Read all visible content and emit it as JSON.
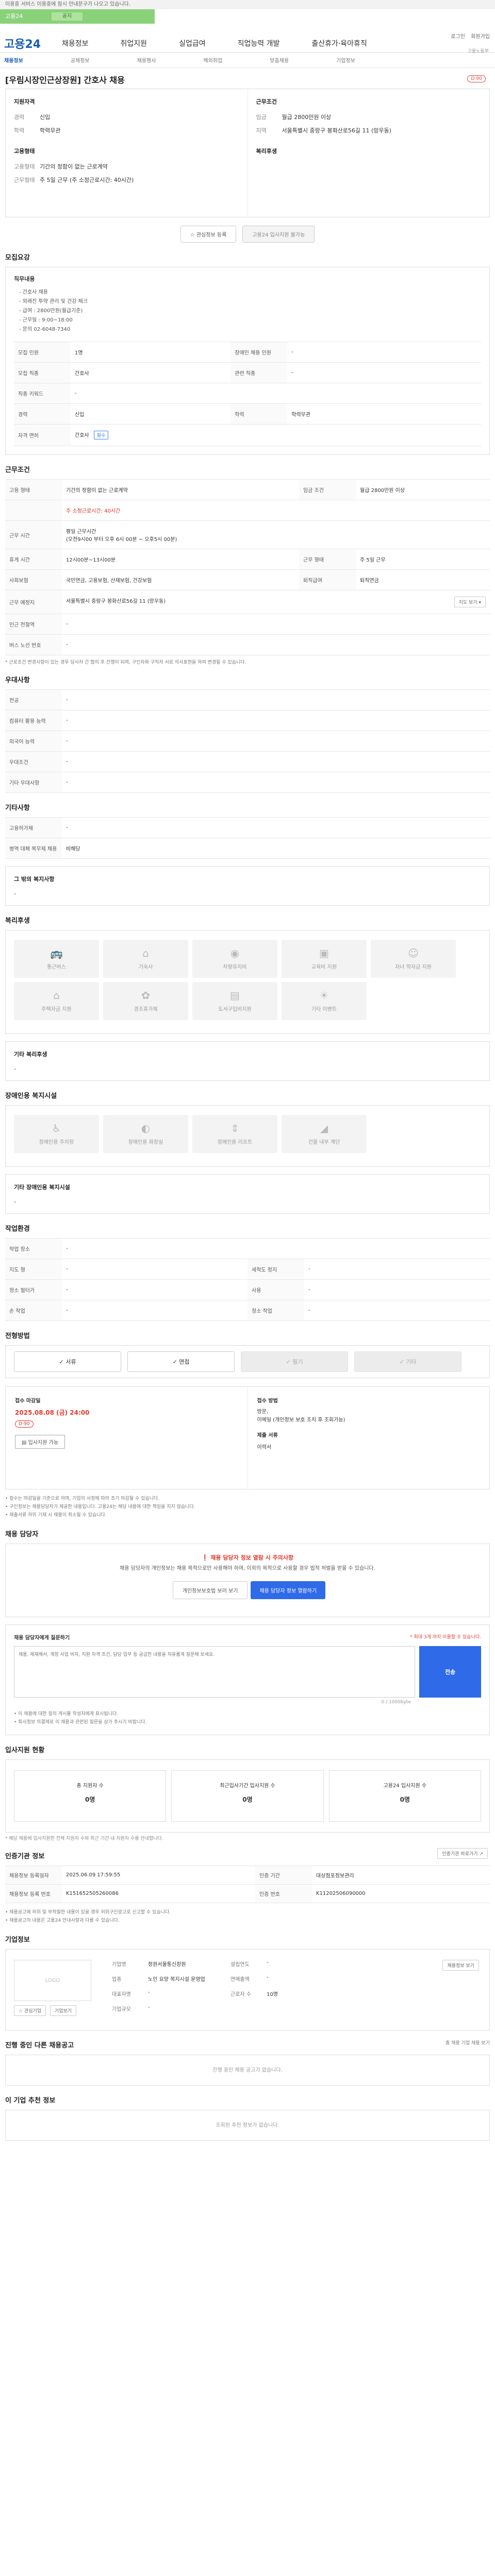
{
  "top": {
    "notice": "이용중 서비스 이용중에 잠시 안내문구가 나오고 있습니다.",
    "green_tab_label": "고용24",
    "green_tab_pill": "공지",
    "util_items": [
      "로그인",
      "회원가입"
    ]
  },
  "header": {
    "logo": "고용24",
    "gnb": [
      "채용정보",
      "취업지원",
      "실업급여",
      "직업능력 개발",
      "출산휴가·육아휴직"
    ],
    "mark": "고용노동부"
  },
  "subnav": [
    "채용정보",
    "공채정보",
    "채용행사",
    "해외취업",
    "맞춤채용",
    "기업정보"
  ],
  "job": {
    "title": "[우림시장인근상장원] 간호사 채용",
    "badge": "D-90"
  },
  "summary": {
    "left_title": "지원자격",
    "left_rows": [
      {
        "k": "경력",
        "v": "신입"
      },
      {
        "k": "학력",
        "v": "학력무관"
      }
    ],
    "left_title2": "고용형태",
    "left_rows2": [
      {
        "k": "고용형태",
        "v": "기간의 정함이 없는 근로계약"
      },
      {
        "k": "근무형태",
        "v": "주 5일 근무 (주 소정근로시간: 40시간)"
      }
    ],
    "right_title": "근무조건",
    "right_rows": [
      {
        "k": "임금",
        "v": "월급 2800만원 이상"
      },
      {
        "k": "지역",
        "v": "서울특별시 중랑구 봉화산로56길 11 (망우동)"
      }
    ],
    "right_title2": "복리후생",
    "right_rows2": []
  },
  "actions": {
    "save": "관심정보 등록",
    "apply": "고용24 입사지원 불가능"
  },
  "recruit": {
    "section_title": "모집요강",
    "duty_head": "직무내용",
    "duties": [
      "- 간호사 채용",
      "- 외래진 투약 관리 및 건강 체크",
      "- 급여 : 2800만원(월급기준)",
      "- 근무일 : 9:00~18:00",
      "- 문의 02-6048-7340"
    ],
    "table": [
      [
        "모집 인원",
        "1명",
        "장애인 채용 인원",
        "-"
      ],
      [
        "모집 직종",
        "간호사",
        "관련 직종",
        "-"
      ],
      [
        "직종 키워드",
        "-",
        "",
        ""
      ],
      [
        "경력",
        "신입",
        "학력",
        "학력무관"
      ],
      [
        "자격 면허",
        "간호사",
        "",
        ""
      ]
    ],
    "license_tag": "필수"
  },
  "work": {
    "section_title": "근무조건",
    "rows": [
      {
        "k": "고용 형태",
        "v": "기간의 정함이 없는 근로계약",
        "k2": "임금 조건",
        "v2": "월급 2800만원 이상"
      },
      {
        "k": "",
        "v": "주 소정근로시간: 40시간",
        "k2": "",
        "v2": ""
      },
      {
        "k": "근무 시간",
        "v": "평일 근무시간\n(오전9시00 부터 오후 6시 00분 ~ 오후5시 00분)",
        "k2": "",
        "v2": ""
      },
      {
        "k": "휴게 시간",
        "v": "12시00분~13시00분",
        "k2": "근무 형태",
        "v2": "주 5일 근무"
      },
      {
        "k": "사회보험",
        "v": "국민연금, 고용보험, 산재보험, 건강보험",
        "k2": "퇴직급여",
        "v2": "퇴직연금"
      },
      {
        "k": "근무 예정지",
        "v": "서울특별시 중랑구 봉화산로56길 11 (망우동)",
        "k2": "",
        "v2": ""
      },
      {
        "k": "인근 전철역",
        "v": "-",
        "k2": "",
        "v2": ""
      },
      {
        "k": "버스 노선 번호",
        "v": "-",
        "k2": "",
        "v2": ""
      }
    ],
    "map_btn": "지도 보기",
    "note": "* 근로조건 변경사항이 있는 경우 당사자 간 협의 후 진행이 되며, 구인자와 구직자 서로 의사표현을 하여 변경될 수 있습니다."
  },
  "pref": {
    "section_title": "우대사항",
    "rows": [
      [
        "전공",
        "-"
      ],
      [
        "컴퓨터 활용 능력",
        "-"
      ],
      [
        "외국어 능력",
        "-"
      ],
      [
        "우대조건",
        "-"
      ],
      [
        "기타 우대사항",
        "-"
      ]
    ]
  },
  "extra": {
    "section_title": "기타사항",
    "rows": [
      [
        "고용허가제",
        "-"
      ],
      [
        "병역 대체 복무제 채용",
        "비해당"
      ]
    ],
    "other_head": "그 밖의 복지사항",
    "other_val": "-"
  },
  "welfare": {
    "section_title": "복리후생",
    "items": [
      {
        "icon": "bus-icon",
        "label": "통근버스"
      },
      {
        "icon": "house-icon",
        "label": "기숙사"
      },
      {
        "icon": "meal-icon",
        "label": "차량유지비"
      },
      {
        "icon": "briefcase-icon",
        "label": "교육비 지원"
      },
      {
        "icon": "person-icon",
        "label": "자녀 학자금 지원"
      },
      {
        "icon": "home-icon",
        "label": "주택자금 지원"
      },
      {
        "icon": "gift-icon",
        "label": "경조휴가제"
      },
      {
        "icon": "book-icon",
        "label": "도서구입비지원"
      },
      {
        "icon": "vacation-icon",
        "label": "기타 이벤트"
      }
    ],
    "other_head": "기타 복리후생",
    "other_val": "-"
  },
  "disabled": {
    "section_title": "장애인용 복지시설",
    "items": [
      {
        "icon": "wheelchair-icon",
        "label": "장애인용 주차장"
      },
      {
        "icon": "toilet-icon",
        "label": "장애인용 화장실"
      },
      {
        "icon": "elevator-icon",
        "label": "장애인용 리프트"
      },
      {
        "icon": "ramp-icon",
        "label": "건물 내부 계단"
      }
    ],
    "other_head": "기타 장애인용 복지시설",
    "other_val": "-"
  },
  "envir": {
    "section_title": "작업환경",
    "rows": [
      [
        "작업 장소",
        "-",
        "",
        ""
      ],
      [
        "지도 형",
        "-",
        "세척도 정지",
        "-"
      ],
      [
        "청소 필터가",
        "-",
        "사용",
        "-"
      ],
      [
        "손 작업",
        "-",
        "청소 작업",
        "-"
      ]
    ]
  },
  "process": {
    "section_title": "전형방법",
    "tabs": [
      {
        "label": "서류",
        "disabled": false
      },
      {
        "label": "면접",
        "disabled": false
      },
      {
        "label": "필기",
        "disabled": true
      },
      {
        "label": "기타",
        "disabled": true
      }
    ]
  },
  "deadline": {
    "left_head": "접수 마감일",
    "date": "2025.08.08 (금) 24:00",
    "dday": "D-90",
    "apply_btn": "입사지원 가능",
    "right_head": "접수 방법",
    "methods": [
      "방문,",
      "이메일 (개인정보 보호 조치 후 조회가능)"
    ],
    "right_head2": "제출 서류",
    "docs": [
      "이력서"
    ],
    "notes": [
      "• 접수는 마감일을 기준으로 하며, 기업의 사정에 따라 조기 마감될 수 있습니다.",
      "• 구인정보는 채용담당자가 제공한 내용입니다. 고용24는 해당 내용에 대한 책임을 지지 않습니다.",
      "• 제출서류 허위 기재 시 채용이 취소될 수 있습니다."
    ]
  },
  "contact": {
    "section_title": "채용 담당자",
    "warn": "채용 담당자 정보 열람 시 주의사항",
    "desc": "채용 담당자의 개인정보는 채용 목적으로만 사용해야 하며, 이외의 목적으로 사용할 경우 법적 처벌을 받을 수 있습니다.",
    "btn_gray": "개인정보보호법 보러 보기",
    "btn_blue": "채용 담당자 정보 열람하기",
    "inquiry_head": "채용 담당자에게 질문하기",
    "inquiry_hint": "* 최대 3개 까지 이용할 수 있습니다.",
    "placeholder": "채용, 제재해서, 계정 사업 비자, 지원 자격 조건, 담당 업무 등 궁금한 내용을 자유롭게 질문해 보세요.",
    "send": "전송",
    "counter": "0 / 1000byte",
    "notes": [
      "• 이 채용에 대한 질의 게시물 작성자에게 표시됩니다.",
      "• 회사정보 의결제로 이 채용과 관련된 질문을 삼가 주시기 바랍니다."
    ]
  },
  "status": {
    "section_title": "입사지원 현황",
    "cards": [
      {
        "label": "총 지원자 수",
        "num": "0명"
      },
      {
        "label": "최근입사기간 입사지원 수",
        "num": "0명"
      },
      {
        "label": "고용24 입사지원 수",
        "num": "0명"
      }
    ],
    "note": "* 해당 채용에 입사지원한 전체 지원자 수와 최근 기간 내 지원자 수를 안내합니다."
  },
  "recruit_info": {
    "section_title": "인증기관 정보",
    "link": "인증기관 바로가기",
    "rows": [
      {
        "k": "채용정보 등록일자",
        "v": "2025.06.09 17:59:55",
        "k2": "인증 기간",
        "v2": "대상점포정보관리"
      },
      {
        "k": "채용정보 등록 번호",
        "v": "K151652505260086",
        "k2": "인증 번호",
        "v2": "K11202506090000"
      }
    ],
    "notes": [
      "• 채용공고에 허위 및 부적절한 내용이 있을 경우 허위구인광고로 신고할 수 있습니다.",
      "• 채용공고의 내용은 고용24 안내사항과 다를 수 있습니다."
    ]
  },
  "company": {
    "section_title": "기업정보",
    "logo_alt": "LOGO",
    "btn1": "관심기업",
    "btn2": "기업보기",
    "rows": [
      {
        "k": "기업명",
        "v": "정원서울통신장원",
        "k2": "설립연도",
        "v2": "-"
      },
      {
        "k": "업종",
        "v": "노인 요양 복지시설 운영업",
        "k2": "연매출액",
        "v2": "-"
      },
      {
        "k": "대표자명",
        "v": "-",
        "k2": "근로자 수",
        "v2": "10명"
      },
      {
        "k": "기업규모",
        "v": "-",
        "k2": "",
        "v2": ""
      }
    ],
    "more_btn": "채용정보 보기"
  },
  "more_jobs": {
    "section_title": "진행 중인 다른 채용공고",
    "link": "총 채용 기업 채용 보기",
    "empty": "진행 중인 채용 공고가 없습니다."
  },
  "recommend": {
    "section_title": "이 기업 추천 정보",
    "empty": "조회된 추천 정보가 없습니다."
  }
}
